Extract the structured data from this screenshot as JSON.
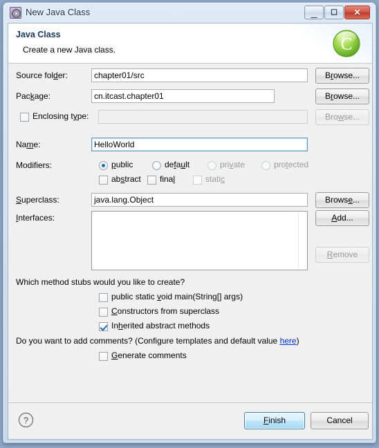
{
  "window": {
    "title": "New Java Class",
    "icon": "java-class-icon",
    "controls": {
      "minimize": "minimize-icon",
      "maximize": "maximize-icon",
      "close": "close-icon"
    }
  },
  "banner": {
    "title": "Java Class",
    "subtitle": "Create a new Java class.",
    "icon": "green-c-wizard-icon"
  },
  "form": {
    "source_folder": {
      "label": "Source fol<u>d</u>er:",
      "value": "chapter01/src",
      "browse": "B<u>r</u>owse..."
    },
    "package": {
      "label": "Pac<u>k</u>age:",
      "value": "cn.itcast.chapter01",
      "browse": "B<u>r</u>owse..."
    },
    "enclosing_type": {
      "label": "Enclosing t<u>y</u>pe:",
      "value": "",
      "checked": false,
      "browse": "Bro<u>w</u>se...",
      "disabled": true
    },
    "name": {
      "label": "Na<u>m</u>e:",
      "value": "HelloWorld"
    },
    "modifiers": {
      "label": "Modifiers:",
      "radios": [
        {
          "label": "<u>p</u>ublic",
          "selected": true,
          "disabled": false
        },
        {
          "label": "de<u>f</u>a<u>u</u>lt",
          "selected": false,
          "disabled": false
        },
        {
          "label": "pri<u>v</u>ate",
          "selected": false,
          "disabled": true
        },
        {
          "label": "pro<u>t</u>ected",
          "selected": false,
          "disabled": true
        }
      ],
      "checkboxes": [
        {
          "label": "ab<u>s</u>tract",
          "checked": false,
          "disabled": false
        },
        {
          "label": "fina<u>l</u>",
          "checked": false,
          "disabled": false
        },
        {
          "label": "stati<u>c</u>",
          "checked": false,
          "disabled": true
        }
      ]
    },
    "superclass": {
      "label": "<u>S</u>uperclass:",
      "value": "java.lang.Object",
      "browse": "Brows<u>e</u>..."
    },
    "interfaces": {
      "label": "<u>I</u>nterfaces:",
      "items": [],
      "add": "<u>A</u>dd...",
      "remove": "<u>R</u>emove",
      "remove_disabled": true
    }
  },
  "stubs": {
    "question": "Which method stubs would you like to create?",
    "options": [
      {
        "label": "public static <u>v</u>oid main(String[] args)",
        "checked": false
      },
      {
        "label": "<u>C</u>onstructors from superclass",
        "checked": false
      },
      {
        "label": "In<u>h</u>erited abstract methods",
        "checked": true
      }
    ]
  },
  "comments": {
    "question_prefix": "Do you want to add comments? (Configure templates and default value ",
    "link": "here",
    "question_suffix": ")",
    "option": {
      "label": "<u>G</u>enerate comments",
      "checked": false
    }
  },
  "footer": {
    "help": "help-icon",
    "finish": "<u>F</u>inish",
    "cancel": "Cancel"
  },
  "colors": {
    "accent": "#1d6fb5",
    "link": "#0033cc",
    "banner_title": "#17365d",
    "disabled_text": "#9a9a9a",
    "close_button": "#cf5543",
    "wizard_icon": "#7ac143"
  }
}
